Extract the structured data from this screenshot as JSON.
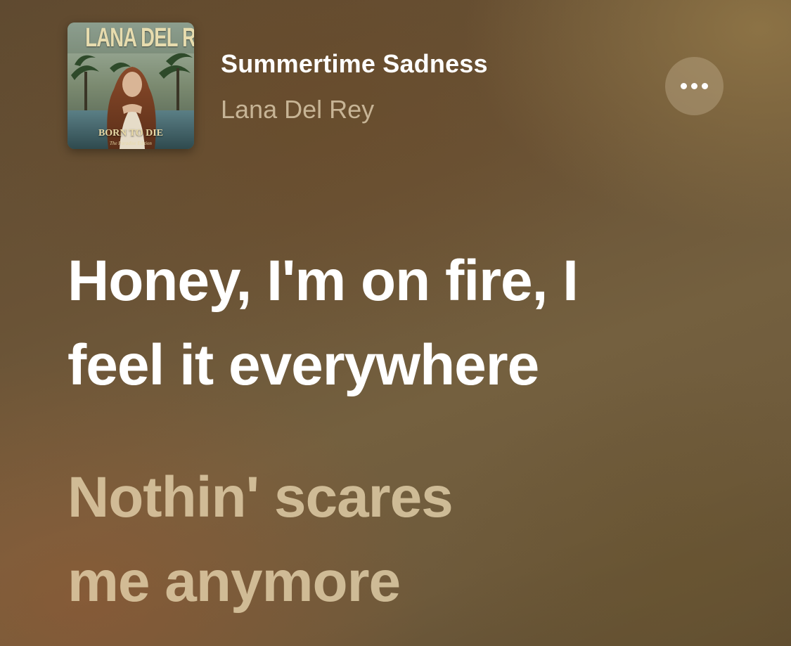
{
  "now_playing": {
    "album_art": {
      "artist_text": "LANA DEL REY",
      "title_text": "BORN TO DIE",
      "edition_text": "The Paradise Edition"
    },
    "title": "Summertime Sadness",
    "artist": "Lana Del Rey",
    "more_icon": "ellipsis-icon"
  },
  "lyrics": {
    "active_line": "Honey, I'm on fire, I\nfeel it everywhere",
    "next_line": "Nothin' scares\nme anymore"
  },
  "colors": {
    "active_lyric": "#ffffff",
    "inactive_lyric": "#d9c7a2",
    "background": "#6a5336"
  }
}
